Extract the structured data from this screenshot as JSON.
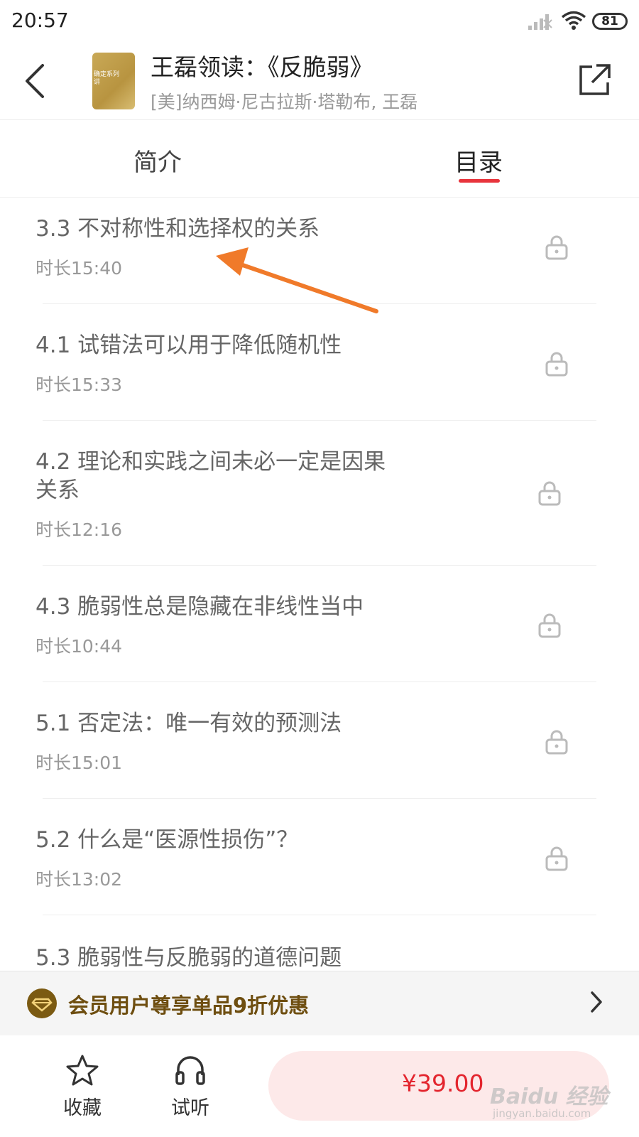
{
  "status_bar": {
    "time": "20:57",
    "battery": "81"
  },
  "header": {
    "title": "王磊领读：《反脆弱》",
    "author": "[美]纳西姆·尼古拉斯·塔勒布, 王磊",
    "cover_text_line1": "确定系列",
    "cover_text_line2": "讲"
  },
  "tabs": [
    {
      "label": "简介",
      "active": false
    },
    {
      "label": "目录",
      "active": true
    }
  ],
  "chapters": [
    {
      "title_line1": "3.3 不对称性和选择权的关系",
      "title_line2": "",
      "duration": "时长15:40",
      "locked": true
    },
    {
      "title_line1": "4.1 试错法可以用于降低随机性",
      "title_line2": "",
      "duration": "时长15:33",
      "locked": true
    },
    {
      "title_line1": "4.2 理论和实践之间未必一定是因果",
      "title_line2": "关系",
      "duration": "时长12:16",
      "locked": true
    },
    {
      "title_line1": "4.3 脆弱性总是隐藏在非线性当中",
      "title_line2": "",
      "duration": "时长10:44",
      "locked": true
    },
    {
      "title_line1": "5.1 否定法：唯一有效的预测法",
      "title_line2": "",
      "duration": "时长15:01",
      "locked": true
    },
    {
      "title_line1": "5.2 什么是“医源性损伤”？",
      "title_line2": "",
      "duration": "时长13:02",
      "locked": true
    },
    {
      "title_line1": "5.3 脆弱性与反脆弱的道德问题",
      "title_line2": "",
      "duration": "",
      "locked": true
    }
  ],
  "member_banner": {
    "text": "会员用户尊享单品9折优惠"
  },
  "bottom_bar": {
    "favorite_label": "收藏",
    "preview_label": "试听",
    "price": "¥39.00"
  },
  "watermark": {
    "text": "Baidu 经验",
    "sub": "jingyan.baidu.com"
  },
  "colors": {
    "accent": "#e8343c",
    "price": "#e3252e",
    "member_gold": "#6e4e10",
    "annotation_arrow": "#f07a2a"
  }
}
